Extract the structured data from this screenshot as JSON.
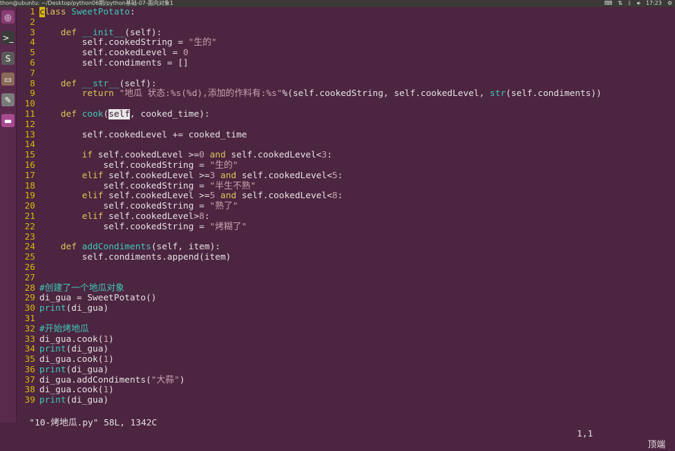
{
  "topbar": {
    "title": "thon@ubuntu: ~/Desktop/python06期/python基础-07-面向对象1",
    "time": "17:23",
    "tray_icons": [
      "keyboard-icon",
      "network-icon",
      "bluetooth-icon",
      "volume-icon",
      "gear-icon"
    ]
  },
  "launcher": {
    "items": [
      {
        "name": "ubuntu-dash-icon",
        "glyph": "◎",
        "color": "#8a3e75"
      },
      {
        "name": "terminal-icon",
        "glyph": ">_",
        "color": "#3a3a3a"
      },
      {
        "name": "sublime-text-icon",
        "glyph": "S",
        "color": "#5a5a5a"
      },
      {
        "name": "files-icon",
        "glyph": "▭",
        "color": "#8a6a5a"
      },
      {
        "name": "settings-icon",
        "glyph": "✎",
        "color": "#7a7a7a"
      },
      {
        "name": "app-icon",
        "glyph": "▬",
        "color": "#a84a90"
      }
    ]
  },
  "code": [
    [
      [
        "cur",
        "c"
      ],
      [
        "kw",
        "lass "
      ],
      [
        "fn",
        "SweetPotato"
      ],
      [
        "t",
        ":"
      ]
    ],
    [],
    [
      [
        "t",
        "    "
      ],
      [
        "kw",
        "def "
      ],
      [
        "fn",
        "__init__"
      ],
      [
        "t",
        "(self):"
      ]
    ],
    [
      [
        "t",
        "        self.cookedString = "
      ],
      [
        "str",
        "\"生的\""
      ]
    ],
    [
      [
        "t",
        "        self.cookedLevel = "
      ],
      [
        "str",
        "0"
      ]
    ],
    [
      [
        "t",
        "        self.condiments = []"
      ]
    ],
    [],
    [
      [
        "t",
        "    "
      ],
      [
        "kw",
        "def "
      ],
      [
        "fn",
        "__str__"
      ],
      [
        "t",
        "(self):"
      ]
    ],
    [
      [
        "t",
        "        "
      ],
      [
        "kw",
        "return "
      ],
      [
        "str",
        "\"地瓜 状态:%s(%d),添加的作料有:%s\""
      ],
      [
        "t",
        "%(self.cookedString, self.cookedLevel, "
      ],
      [
        "fn",
        "str"
      ],
      [
        "t",
        "(self.condiments))"
      ]
    ],
    [],
    [
      [
        "t",
        "    "
      ],
      [
        "kw",
        "def "
      ],
      [
        "fn",
        "cook"
      ],
      [
        "t",
        "("
      ],
      [
        "hl",
        "self"
      ],
      [
        "t",
        ", cooked_time):"
      ]
    ],
    [],
    [
      [
        "t",
        "        self.cookedLevel += cooked_time"
      ]
    ],
    [],
    [
      [
        "t",
        "        "
      ],
      [
        "kw",
        "if "
      ],
      [
        "t",
        "self.cookedLevel >="
      ],
      [
        "str",
        "0"
      ],
      [
        "kw",
        " and "
      ],
      [
        "t",
        "self.cookedLevel<"
      ],
      [
        "str",
        "3"
      ],
      [
        "t",
        ":"
      ]
    ],
    [
      [
        "t",
        "            self.cookedString = "
      ],
      [
        "str",
        "\"生的\""
      ]
    ],
    [
      [
        "t",
        "        "
      ],
      [
        "kw",
        "elif "
      ],
      [
        "t",
        "self.cookedLevel >="
      ],
      [
        "str",
        "3"
      ],
      [
        "kw",
        " and "
      ],
      [
        "t",
        "self.cookedLevel<"
      ],
      [
        "str",
        "5"
      ],
      [
        "t",
        ":"
      ]
    ],
    [
      [
        "t",
        "            self.cookedString = "
      ],
      [
        "str",
        "\"半生不熟\""
      ]
    ],
    [
      [
        "t",
        "        "
      ],
      [
        "kw",
        "elif "
      ],
      [
        "t",
        "self.cookedLevel >="
      ],
      [
        "str",
        "5"
      ],
      [
        "kw",
        " and "
      ],
      [
        "t",
        "self.cookedLevel<"
      ],
      [
        "str",
        "8"
      ],
      [
        "t",
        ":"
      ]
    ],
    [
      [
        "t",
        "            self.cookedString = "
      ],
      [
        "str",
        "\"熟了\""
      ]
    ],
    [
      [
        "t",
        "        "
      ],
      [
        "kw",
        "elif "
      ],
      [
        "t",
        "self.cookedLevel>"
      ],
      [
        "str",
        "8"
      ],
      [
        "t",
        ":"
      ]
    ],
    [
      [
        "t",
        "            self.cookedString = "
      ],
      [
        "str",
        "\"烤糊了\""
      ]
    ],
    [],
    [
      [
        "t",
        "    "
      ],
      [
        "kw",
        "def "
      ],
      [
        "fn",
        "addCondiments"
      ],
      [
        "t",
        "(self, item):"
      ]
    ],
    [
      [
        "t",
        "        self.condiments.append(item)"
      ]
    ],
    [],
    [],
    [
      [
        "cm",
        "#创建了一个地瓜对象"
      ]
    ],
    [
      [
        "t",
        "di_gua = SweetPotato()"
      ]
    ],
    [
      [
        "fn",
        "print"
      ],
      [
        "t",
        "(di_gua)"
      ]
    ],
    [],
    [
      [
        "cm",
        "#开始烤地瓜"
      ]
    ],
    [
      [
        "t",
        "di_gua.cook("
      ],
      [
        "str",
        "1"
      ],
      [
        "t",
        ")"
      ]
    ],
    [
      [
        "fn",
        "print"
      ],
      [
        "t",
        "(di_gua)"
      ]
    ],
    [
      [
        "t",
        "di_gua.cook("
      ],
      [
        "str",
        "1"
      ],
      [
        "t",
        ")"
      ]
    ],
    [
      [
        "fn",
        "print"
      ],
      [
        "t",
        "(di_gua)"
      ]
    ],
    [
      [
        "t",
        "di_gua.addCondiments("
      ],
      [
        "str",
        "\"大蒜\""
      ],
      [
        "t",
        ")"
      ]
    ],
    [
      [
        "t",
        "di_gua.cook("
      ],
      [
        "str",
        "1"
      ],
      [
        "t",
        ")"
      ]
    ],
    [
      [
        "fn",
        "print"
      ],
      [
        "t",
        "(di_gua)"
      ]
    ]
  ],
  "status": {
    "file": "\"10-烤地瓜.py\" 58L, 1342C",
    "position": "1,1",
    "scroll": "顶端"
  }
}
